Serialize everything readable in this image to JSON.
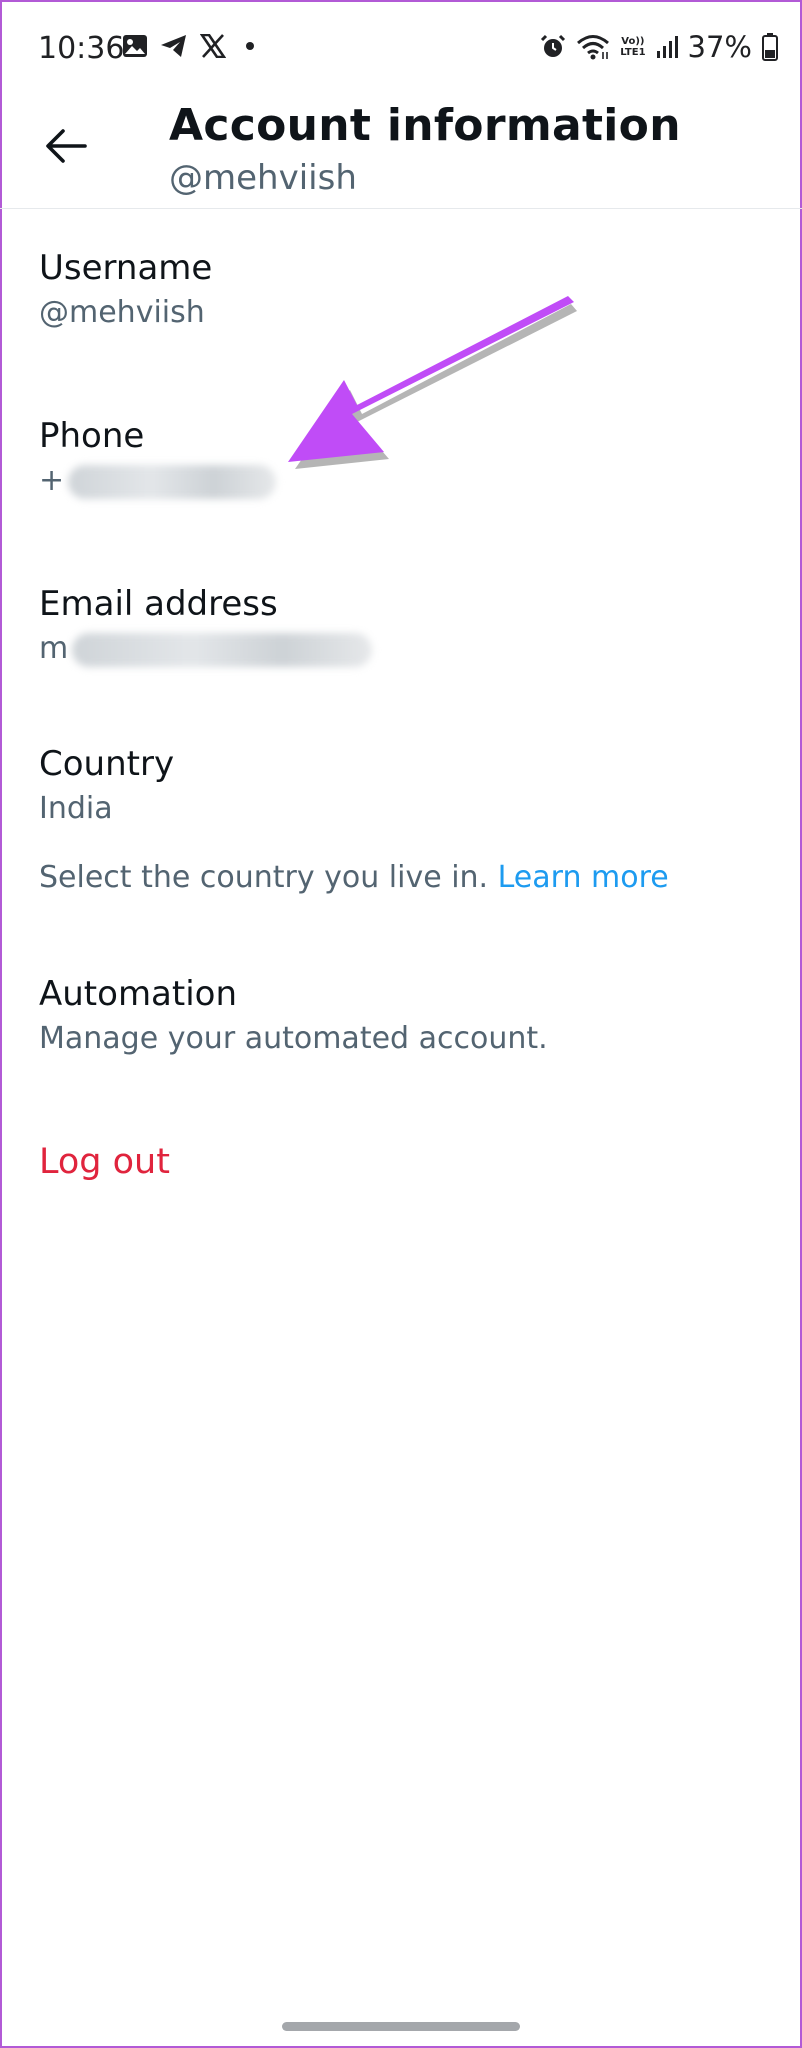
{
  "status_bar": {
    "time": "10:36",
    "battery_percent": "37%",
    "network_badge_top": "Vo))",
    "network_badge_bottom": "LTE1",
    "left_icons": [
      "gallery-icon",
      "telegram-icon",
      "x-logo-icon",
      "notification-dot"
    ],
    "right_icons": [
      "alarm-icon",
      "wifi-icon",
      "volte-icon",
      "signal-icon",
      "battery-icon"
    ]
  },
  "header": {
    "title": "Account information",
    "subtitle": "@mehviish",
    "back_icon": "back-arrow-icon"
  },
  "rows": {
    "username": {
      "label": "Username",
      "value": "@mehviish"
    },
    "phone": {
      "label": "Phone",
      "value_prefix": "+"
    },
    "email": {
      "label": "Email address",
      "value_prefix": "m"
    },
    "country": {
      "label": "Country",
      "value": "India"
    },
    "automation": {
      "label": "Automation",
      "value": "Manage your automated account."
    }
  },
  "country_hint": {
    "text": "Select the country you live in.",
    "link": "Learn more"
  },
  "logout": {
    "label": "Log out"
  },
  "colors": {
    "primary_text": "#0f1419",
    "secondary_text": "#536471",
    "link": "#1d9bf0",
    "danger": "#e0243d",
    "annotation_arrow": "#c04cf7",
    "frame_border": "#b25ad6"
  }
}
